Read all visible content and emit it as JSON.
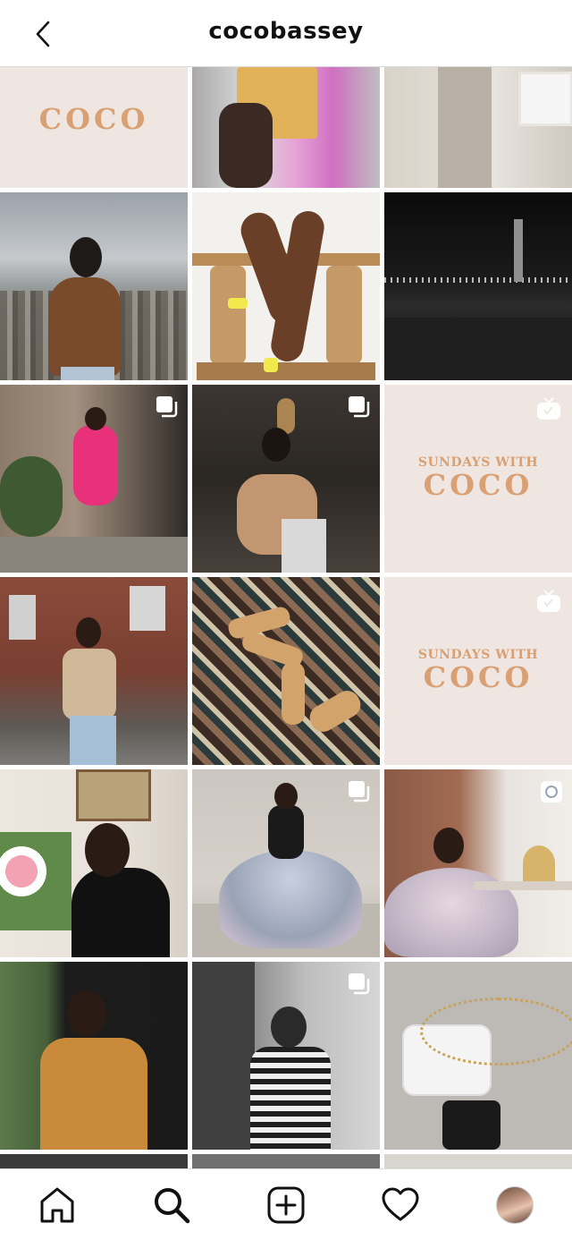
{
  "header": {
    "username": "cocobassey",
    "back_icon": "chevron-left-icon"
  },
  "promo_tiles": [
    {
      "small_text": "",
      "big_text": "COCO"
    },
    {
      "small_text": "SUNDAYS WITH",
      "big_text": "COCO"
    },
    {
      "small_text": "SUNDAYS WITH",
      "big_text": "COCO"
    }
  ],
  "tabbar": {
    "items": [
      {
        "name": "home",
        "icon": "home-icon"
      },
      {
        "name": "search",
        "icon": "search-icon"
      },
      {
        "name": "create",
        "icon": "plus-square-icon"
      },
      {
        "name": "activity",
        "icon": "heart-icon"
      },
      {
        "name": "profile",
        "icon": "avatar"
      }
    ]
  },
  "colors": {
    "promo_text": "#d9a074",
    "promo_bg": "#efe6e1",
    "divider": "#dbdbdb"
  }
}
